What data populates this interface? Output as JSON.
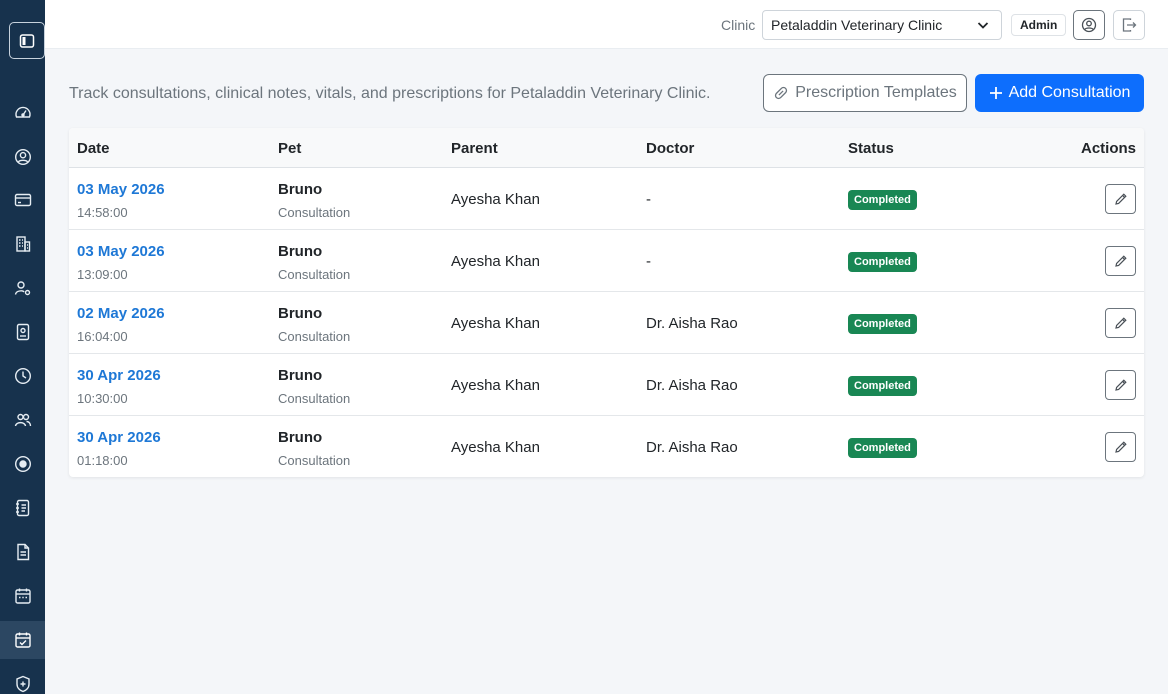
{
  "sidebar": {
    "items": [
      {
        "icon": "speedometer-icon"
      },
      {
        "icon": "user-circle-icon"
      },
      {
        "icon": "credit-card-icon"
      },
      {
        "icon": "building-icon"
      },
      {
        "icon": "user-gear-icon"
      },
      {
        "icon": "id-badge-icon"
      },
      {
        "icon": "clock-icon"
      },
      {
        "icon": "people-icon"
      },
      {
        "icon": "record-circle-icon"
      },
      {
        "icon": "address-book-icon"
      },
      {
        "icon": "document-icon"
      },
      {
        "icon": "calendar-icon"
      },
      {
        "icon": "calendar-check-icon",
        "active": true
      },
      {
        "icon": "shield-plus-icon"
      }
    ]
  },
  "topbar": {
    "clinic_label": "Clinic",
    "clinic_selected": "Petaladdin Veterinary Clinic",
    "role": "Admin"
  },
  "page": {
    "description": "Track consultations, clinical notes, vitals, and prescriptions for Petaladdin Veterinary Clinic.",
    "templates_button": "Prescription Templates",
    "add_button": "Add Consultation"
  },
  "table": {
    "columns": [
      "Date",
      "Pet",
      "Parent",
      "Doctor",
      "Status",
      "Actions"
    ],
    "rows": [
      {
        "date": "03 May 2026",
        "time": "14:58:00",
        "pet": "Bruno",
        "type": "Consultation",
        "parent": "Ayesha Khan",
        "doctor": "-",
        "status": "Completed"
      },
      {
        "date": "03 May 2026",
        "time": "13:09:00",
        "pet": "Bruno",
        "type": "Consultation",
        "parent": "Ayesha Khan",
        "doctor": "-",
        "status": "Completed"
      },
      {
        "date": "02 May 2026",
        "time": "16:04:00",
        "pet": "Bruno",
        "type": "Consultation",
        "parent": "Ayesha Khan",
        "doctor": "Dr. Aisha Rao",
        "status": "Completed"
      },
      {
        "date": "30 Apr 2026",
        "time": "10:30:00",
        "pet": "Bruno",
        "type": "Consultation",
        "parent": "Ayesha Khan",
        "doctor": "Dr. Aisha Rao",
        "status": "Completed"
      },
      {
        "date": "30 Apr 2026",
        "time": "01:18:00",
        "pet": "Bruno",
        "type": "Consultation",
        "parent": "Ayesha Khan",
        "doctor": "Dr. Aisha Rao",
        "status": "Completed"
      }
    ]
  },
  "colors": {
    "sidebar_bg": "#17324d",
    "primary": "#0d6efd",
    "link": "#1e78d6",
    "success": "#198754"
  }
}
